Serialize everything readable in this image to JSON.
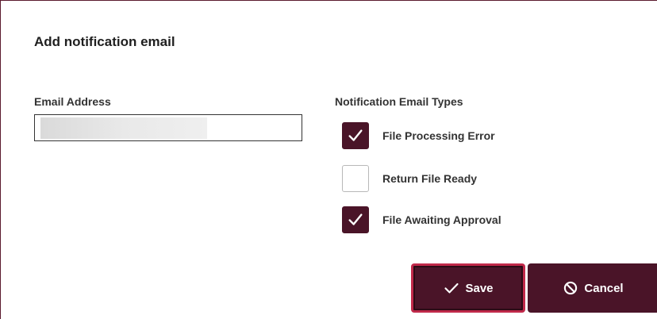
{
  "dialog": {
    "title": "Add notification email"
  },
  "email": {
    "label": "Email Address",
    "value": "",
    "redacted": true
  },
  "notification_types": {
    "label": "Notification Email Types",
    "options": [
      {
        "label": "File Processing Error",
        "checked": true
      },
      {
        "label": "Return File Ready",
        "checked": false
      },
      {
        "label": "File Awaiting Approval",
        "checked": true
      }
    ]
  },
  "actions": {
    "save_label": "Save",
    "save_icon": "checkmark-icon",
    "cancel_label": "Cancel",
    "cancel_icon": "ban-icon"
  },
  "colors": {
    "accent": "#4a1428",
    "focus_ring": "#c0294a",
    "border": "#5b1a2e"
  }
}
